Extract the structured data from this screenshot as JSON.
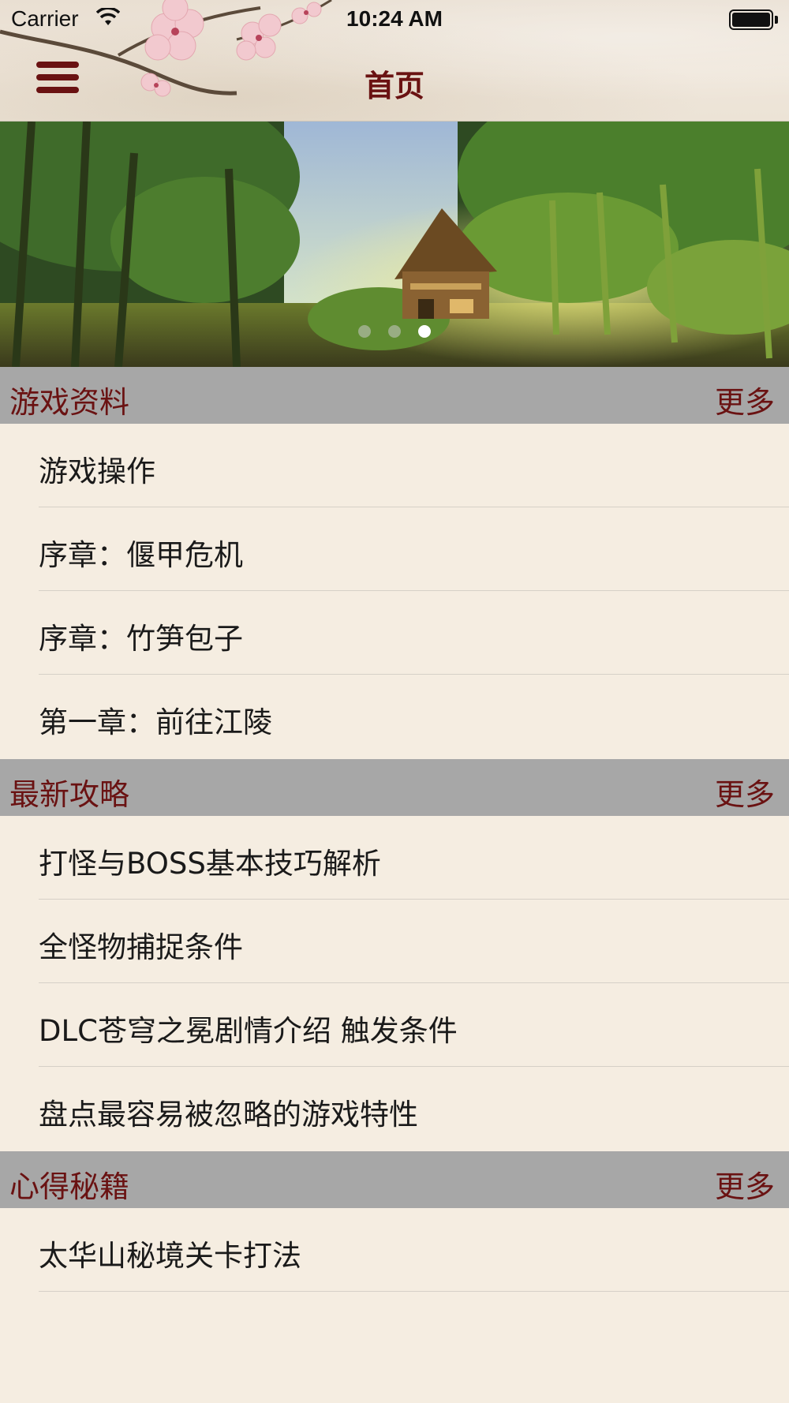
{
  "status_bar": {
    "carrier": "Carrier",
    "time": "10:24 AM"
  },
  "nav": {
    "title": "首页",
    "menu_icon": "hamburger-menu-icon",
    "accent_color": "#6a1212"
  },
  "banner": {
    "page_count": 3,
    "active_page": 3
  },
  "sections": [
    {
      "title": "游戏资料",
      "more": "更多",
      "items": [
        "游戏操作",
        "序章：偃甲危机",
        "序章：竹笋包子",
        "第一章：前往江陵"
      ]
    },
    {
      "title": "最新攻略",
      "more": "更多",
      "items": [
        "打怪与BOSS基本技巧解析",
        "全怪物捕捉条件",
        "DLC苍穹之冕剧情介绍 触发条件",
        "盘点最容易被忽略的游戏特性"
      ]
    },
    {
      "title": "心得秘籍",
      "more": "更多",
      "items": [
        "太华山秘境关卡打法"
      ]
    }
  ],
  "colors": {
    "background": "#f5ede1",
    "section_header": "#a7a7a7",
    "accent": "#6a1212"
  }
}
